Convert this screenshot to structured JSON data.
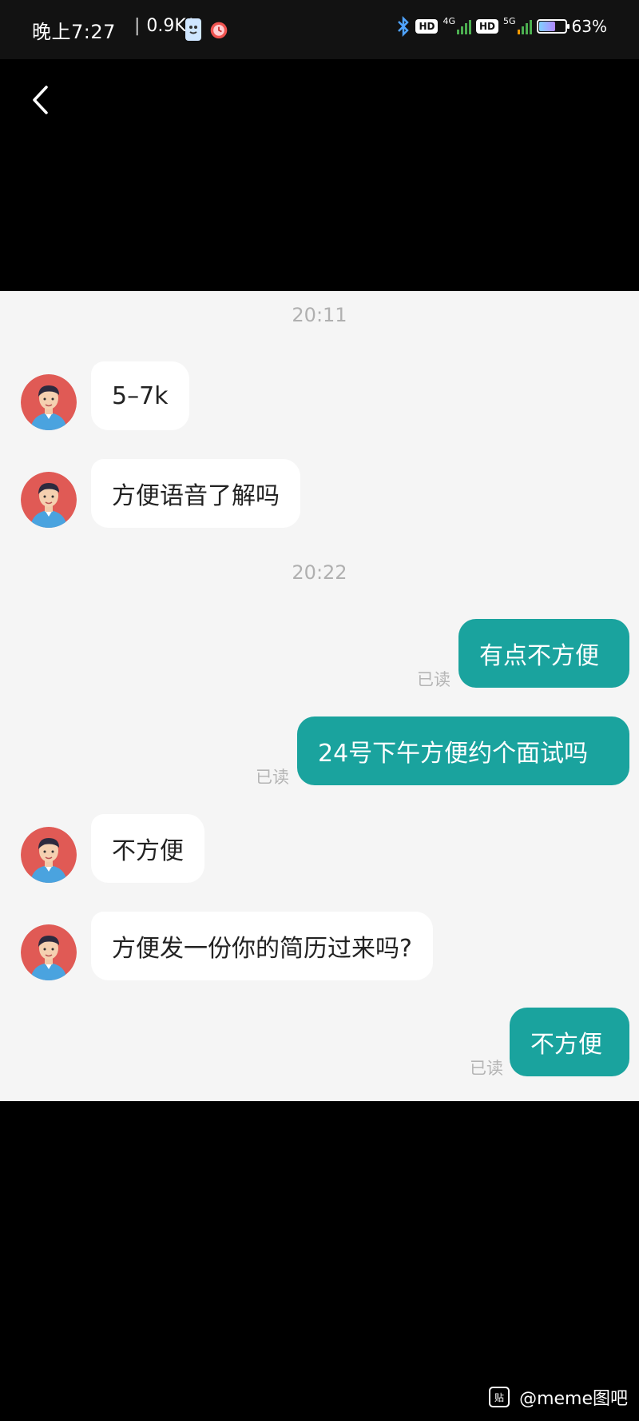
{
  "status_bar": {
    "time": "晚上7:27",
    "net_speed": "0.9K/s",
    "hd1": "HD",
    "net1": "4G",
    "hd2": "HD",
    "net2": "5G",
    "battery": "63%",
    "battery_level": 0.63
  },
  "chat": {
    "messages": [
      {
        "type": "time",
        "text": "20:11"
      },
      {
        "type": "in",
        "text": "5–7k"
      },
      {
        "type": "in",
        "text": "方便语音了解吗"
      },
      {
        "type": "time",
        "text": "20:22"
      },
      {
        "type": "out",
        "text": "有点不方便",
        "read": "已读"
      },
      {
        "type": "out",
        "text": "24号下午方便约个面试吗",
        "read": "已读"
      },
      {
        "type": "in",
        "text": "不方便"
      },
      {
        "type": "in",
        "text": "方便发一份你的简历过来吗?"
      },
      {
        "type": "out",
        "text": "不方便",
        "read": "已读"
      }
    ]
  },
  "watermark": {
    "icon_text": "贴",
    "text": "@meme图吧"
  },
  "colors": {
    "accent": "#1aa39e",
    "chat_bg": "#f5f5f5",
    "avatar_bg": "#e05a55"
  }
}
